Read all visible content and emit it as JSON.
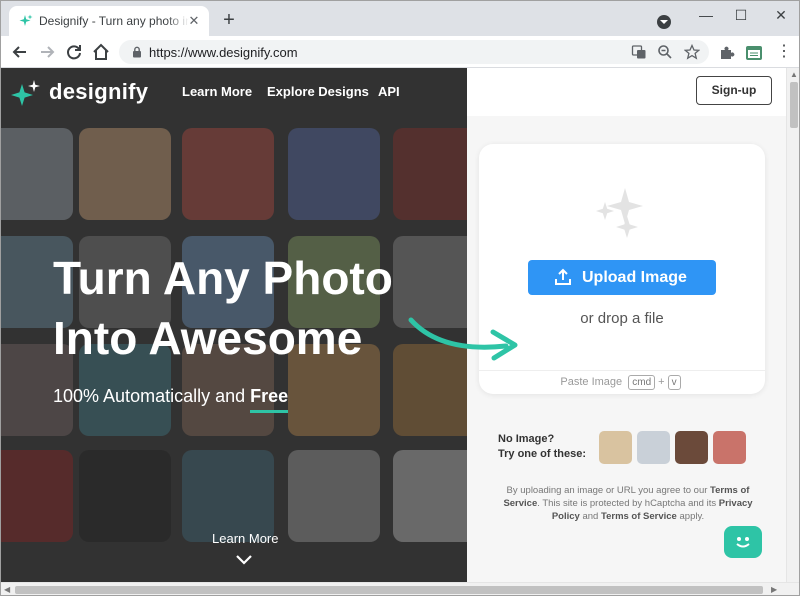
{
  "browser": {
    "tab_title": "Designify - Turn any photo into",
    "tab_close": "✕",
    "new_tab": "+",
    "url": "https://www.designify.com",
    "win_min": "—",
    "win_max": "☐",
    "win_close": "✕"
  },
  "nav": {
    "brand": "designify",
    "links": [
      "Learn More",
      "Explore Designs",
      "API"
    ],
    "signup": "Sign-up"
  },
  "hero": {
    "title": "Turn Any Photo Into Awesome",
    "sub_prefix": "100% Automatically and ",
    "sub_free": "Free",
    "learn_more": "Learn More"
  },
  "upload": {
    "button": "Upload Image",
    "drop": "or drop a file",
    "paste_label": "Paste Image",
    "key_cmd": "cmd",
    "key_plus": "+",
    "key_v": "v"
  },
  "samples": {
    "line1": "No Image?",
    "line2": "Try one of these:"
  },
  "legal": {
    "p1": "By uploading an image or URL you agree to our ",
    "terms": "Terms of Service",
    "p2": ". This site is protected by hCaptcha and its ",
    "privacy": "Privacy Policy",
    "p3": " and ",
    "tos": "Terms of Service",
    "p4": " apply."
  },
  "colors": {
    "accent": "#2ec4a6",
    "upload_button": "#2f95f5"
  }
}
